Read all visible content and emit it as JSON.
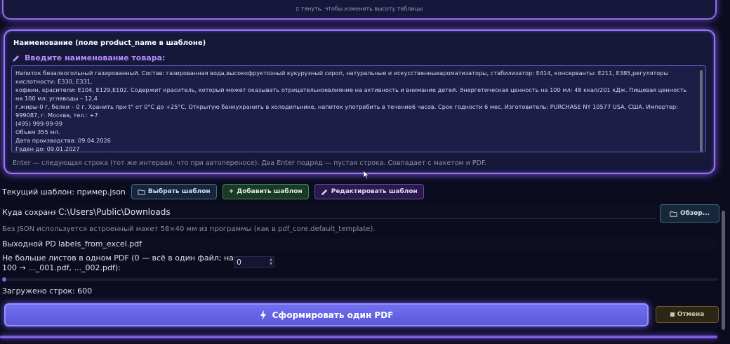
{
  "table": {
    "resize_hint": "▯ тянуть, чтобы изменить высоту таблицы"
  },
  "name_panel": {
    "title": "Наименование (поле product_name в шаблоне)",
    "prompt": "Введите наименование товара:",
    "text_lines": [
      "Напиток безалкогольный газированный. Состав: газированная вода,высокофруктозный кукурузный сироп, натуральные и искусственныеароматизаторы, стабилизатор: E414, консерванты: E211, E385,регуляторы кислотности: E330, E331,",
      "кофеин, красители: E104, E129,E102. Содержит краситель, который может оказывать отрицательноевлияние на активность и внимание детей. Энергетическая ценность на 100 мл: 48 ккал/201 кДж. Пищевая ценность на 100 мл: углеводы – 12,4",
      "г.жиры-0 г, белки – 0 г. Хранить при t° от 0°С до +25°С. Открытую банкухранить в холодильнике, напиток употребить в течение6 часов. Срок годности 6 мес. Изготовитель: PURCHASE NY 10577 USA, США. Импортер: 999087, г. Москва, тел.: +7",
      "(495) 999-99-99",
      "Объем 355 мл.",
      "Дата производства: 09.04.2026",
      "Годен до: 09.01.2027"
    ],
    "hint": "Enter — следующая строка (тот же интервал, что при автопереносе). Два Enter подряд — пустая строка. Совпадает с макетом и PDF."
  },
  "template": {
    "label": "Текущий шаблон: пример.json",
    "choose_button": "Выбрать шаблон",
    "add_button": "Добавить шаблон",
    "edit_button": "Редактировать шаблон"
  },
  "save": {
    "label": "Куда сохранять",
    "path": "C:\\Users\\Public\\Downloads",
    "browse_button": "Обзор...",
    "hint": "Без JSON используется встроенный макет 58×40 мм из программы (как в pdf_core.default_template)."
  },
  "output": {
    "label": "Выходной PDF:",
    "value": "labels_from_excel.pdf"
  },
  "sheets": {
    "label_line1": "Не больше листов в одном PDF (0 — всё в один файл; например",
    "label_line2": "100 → ..._001.pdf, ..._002.pdf):",
    "value": "0"
  },
  "progress": {
    "fraction": 0.0
  },
  "status": {
    "rows_loaded": "Загружено строк: 600"
  },
  "actions": {
    "generate_button": "Сформировать один PDF",
    "cancel_button": "Отмена"
  },
  "colors": {
    "accent": "#8f6ce8",
    "prompt": "#b48cff",
    "generate": "#6f6ff0"
  }
}
